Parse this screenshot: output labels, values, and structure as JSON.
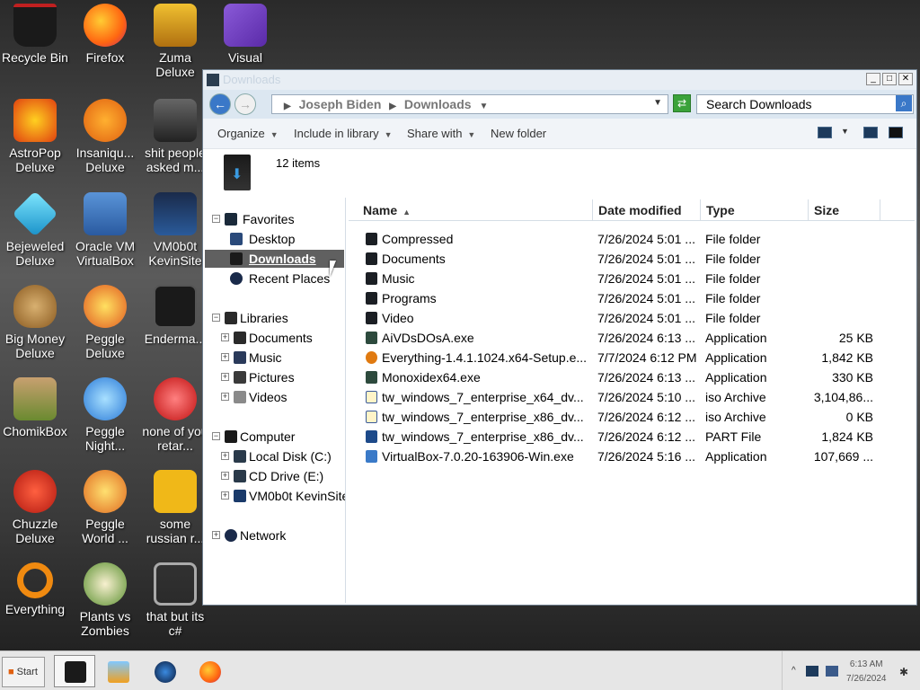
{
  "desktop": {
    "icons": [
      {
        "label": "Recycle Bin",
        "color": "#1a1a1a"
      },
      {
        "label": "Firefox",
        "color": "#e8651a"
      },
      {
        "label": "Zuma Deluxe",
        "color": "#d8a018"
      },
      {
        "label": "Visual",
        "color": "#6a3ab8"
      },
      {
        "label": "AstroPop Deluxe",
        "color": "#e05a18"
      },
      {
        "label": "Insaniqu... Deluxe",
        "color": "#f09018"
      },
      {
        "label": "shit people asked m...",
        "color": "#444444"
      },
      {
        "label": "Bejeweled Deluxe",
        "color": "#38b8e8"
      },
      {
        "label": "Oracle VM VirtualBox",
        "color": "#2a64b0"
      },
      {
        "label": "VM0b0t KevinSite",
        "color": "#1a3a6a"
      },
      {
        "label": "Big Money Deluxe",
        "color": "#a87830"
      },
      {
        "label": "Peggle Deluxe",
        "color": "#e85a20"
      },
      {
        "label": "Enderma...",
        "color": "#202020"
      },
      {
        "label": "ChomikBox",
        "color": "#a08050"
      },
      {
        "label": "Peggle Night...",
        "color": "#3a9ae0"
      },
      {
        "label": "none of you retar...",
        "color": "#d82020"
      },
      {
        "label": "Chuzzle Deluxe",
        "color": "#d83020"
      },
      {
        "label": "Peggle World ...",
        "color": "#e07028"
      },
      {
        "label": "some russian r...",
        "color": "#e8b010"
      },
      {
        "label": "Everything",
        "color": "#e88010"
      },
      {
        "label": "Plants vs Zombies",
        "color": "#6aa038"
      },
      {
        "label": "that but its c#",
        "color": "#808080"
      }
    ]
  },
  "window": {
    "title": "Downloads",
    "address": {
      "part1": "Joseph Biden",
      "part2": "Downloads"
    },
    "search_placeholder": "Search Downloads",
    "toolbar": {
      "organize": "Organize",
      "include": "Include in library",
      "share": "Share with",
      "newfolder": "New folder"
    },
    "item_count": "12 items",
    "nav": {
      "favorites": "Favorites",
      "desktop": "Desktop",
      "downloads": "Downloads",
      "recent": "Recent Places",
      "libraries": "Libraries",
      "documents": "Documents",
      "music": "Music",
      "pictures": "Pictures",
      "videos": "Videos",
      "computer": "Computer",
      "localdisk": "Local Disk (C:)",
      "cddrive": "CD Drive (E:)",
      "vm": "VM0b0t KevinSite",
      "network": "Network"
    },
    "columns": {
      "name": "Name",
      "date": "Date modified",
      "type": "Type",
      "size": "Size"
    },
    "files": [
      {
        "name": "Compressed",
        "date": "7/26/2024 5:01 ...",
        "type": "File folder",
        "size": "",
        "icon": "folder-icon"
      },
      {
        "name": "Documents",
        "date": "7/26/2024 5:01 ...",
        "type": "File folder",
        "size": "",
        "icon": "folder-icon"
      },
      {
        "name": "Music",
        "date": "7/26/2024 5:01 ...",
        "type": "File folder",
        "size": "",
        "icon": "folder-icon"
      },
      {
        "name": "Programs",
        "date": "7/26/2024 5:01 ...",
        "type": "File folder",
        "size": "",
        "icon": "folder-icon"
      },
      {
        "name": "Video",
        "date": "7/26/2024 5:01 ...",
        "type": "File folder",
        "size": "",
        "icon": "folder-icon"
      },
      {
        "name": "AiVDsDOsA.exe",
        "date": "7/26/2024 6:13 ...",
        "type": "Application",
        "size": "25 KB",
        "icon": "exe-icon"
      },
      {
        "name": "Everything-1.4.1.1024.x64-Setup.e...",
        "date": "7/7/2024 6:12 PM",
        "type": "Application",
        "size": "1,842 KB",
        "icon": "search-icon"
      },
      {
        "name": "Monoxidex64.exe",
        "date": "7/26/2024 6:13 ...",
        "type": "Application",
        "size": "330 KB",
        "icon": "exe-icon"
      },
      {
        "name": "tw_windows_7_enterprise_x64_dv...",
        "date": "7/26/2024 5:10 ...",
        "type": "iso Archive",
        "size": "3,104,86...",
        "icon": "iso-icon"
      },
      {
        "name": "tw_windows_7_enterprise_x86_dv...",
        "date": "7/26/2024 6:12 ...",
        "type": "iso Archive",
        "size": "0 KB",
        "icon": "iso-icon"
      },
      {
        "name": "tw_windows_7_enterprise_x86_dv...",
        "date": "7/26/2024 6:12 ...",
        "type": "PART File",
        "size": "1,824 KB",
        "icon": "part-icon"
      },
      {
        "name": "VirtualBox-7.0.20-163906-Win.exe",
        "date": "7/26/2024 5:16 ...",
        "type": "Application",
        "size": "107,669 ...",
        "icon": "virtualbox-icon"
      }
    ]
  },
  "taskbar": {
    "start": "Start",
    "time": "6:13 AM",
    "date": "7/26/2024"
  }
}
